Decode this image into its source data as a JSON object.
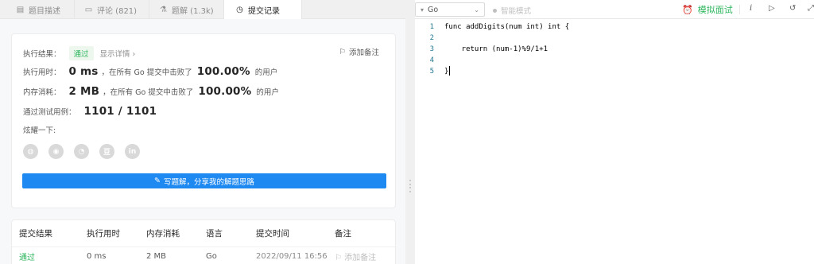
{
  "tabs": [
    {
      "icon": "document-icon",
      "label": "题目描述"
    },
    {
      "icon": "comment-icon",
      "label": "评论 (821)"
    },
    {
      "icon": "flask-icon",
      "label": "题解 (1.3k)"
    },
    {
      "icon": "clock-icon",
      "label": "提交记录"
    }
  ],
  "result": {
    "label": "执行结果：",
    "status": "通过",
    "detail": "显示详情 ›",
    "add_note": "添加备注",
    "runtime_label": "执行用时：",
    "runtime_value": "0 ms",
    "runtime_mid": "，在所有 Go 提交中击败了",
    "runtime_pct": "100.00%",
    "runtime_tail": "的用户",
    "memory_label": "内存消耗：",
    "memory_value": "2 MB",
    "memory_mid": "，在所有 Go 提交中击败了",
    "memory_pct": "100.00%",
    "memory_tail": "的用户",
    "tests_label": "通过测试用例：",
    "tests_value": "1101 / 1101",
    "share_label": "炫耀一下:",
    "share_icons": [
      "wechat-icon",
      "weibo-icon",
      "qq-icon",
      "douban-icon",
      "linkedin-icon"
    ],
    "share_glyphs": [
      "◍",
      "◉",
      "◔",
      "豆",
      "in"
    ],
    "write_button": "写题解，分享我的解题思路"
  },
  "table": {
    "headers": [
      "提交结果",
      "执行用时",
      "内存消耗",
      "语言",
      "提交时间",
      "备注"
    ],
    "row": {
      "result": "通过",
      "runtime": "0 ms",
      "memory": "2 MB",
      "lang": "Go",
      "time": "2022/09/11 16:56",
      "note": "添加备注"
    }
  },
  "toolbar": {
    "language": "Go",
    "smart_mode": "智能模式",
    "interview": "模拟面试",
    "info": "i"
  },
  "editor": {
    "line_numbers": [
      "1",
      "2",
      "3",
      "4",
      "5"
    ],
    "lines": [
      "func addDigits(num int) int {",
      "",
      "    return (num-1)%9/1+1",
      "",
      "}"
    ]
  },
  "colors": {
    "accent_green": "#2db55d",
    "button_blue": "#1e89f0"
  }
}
